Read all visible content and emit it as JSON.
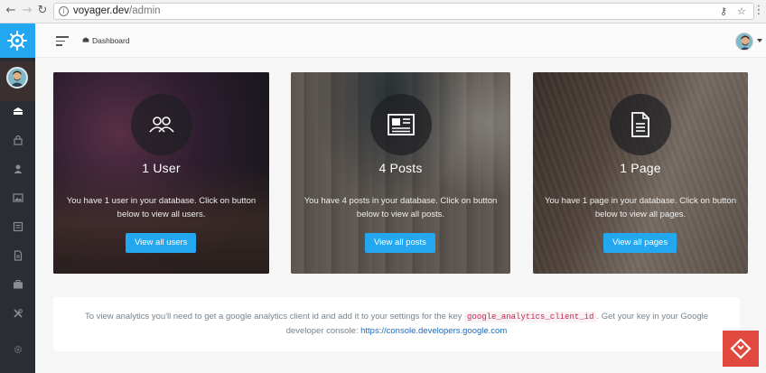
{
  "browser": {
    "url_host": "voyager.dev",
    "url_path": "/admin"
  },
  "header": {
    "breadcrumb": "Dashboard"
  },
  "cards": [
    {
      "title": "1 User",
      "description": "You have 1 user in your database. Click on button below to view all users.",
      "button": "View all users"
    },
    {
      "title": "4 Posts",
      "description": "You have 4 posts in your database. Click on button below to view all posts.",
      "button": "View all posts"
    },
    {
      "title": "1 Page",
      "description": "You have 1 page in your database. Click on button below to view all pages.",
      "button": "View all pages"
    }
  ],
  "analytics": {
    "text_before": "To view analytics you'll need to get a google analytics client id and add it to your settings for the key",
    "key": "google_analytics_client_id",
    "text_after": ". Get your key in your Google developer console:",
    "link": "https://console.developers.google.com"
  },
  "icons": {
    "sidebar": [
      "helm-logo-icon",
      "dashboard-icon",
      "lock-icon",
      "user-icon",
      "image-icon",
      "posts-icon",
      "page-icon",
      "briefcase-icon",
      "tools-icon",
      "gear-icon"
    ],
    "cards": [
      "users-icon",
      "newspaper-icon",
      "document-icon"
    ]
  },
  "colors": {
    "accent": "#22a7f0",
    "sidebar": "#2a2d33",
    "badge": "#e2493e"
  }
}
